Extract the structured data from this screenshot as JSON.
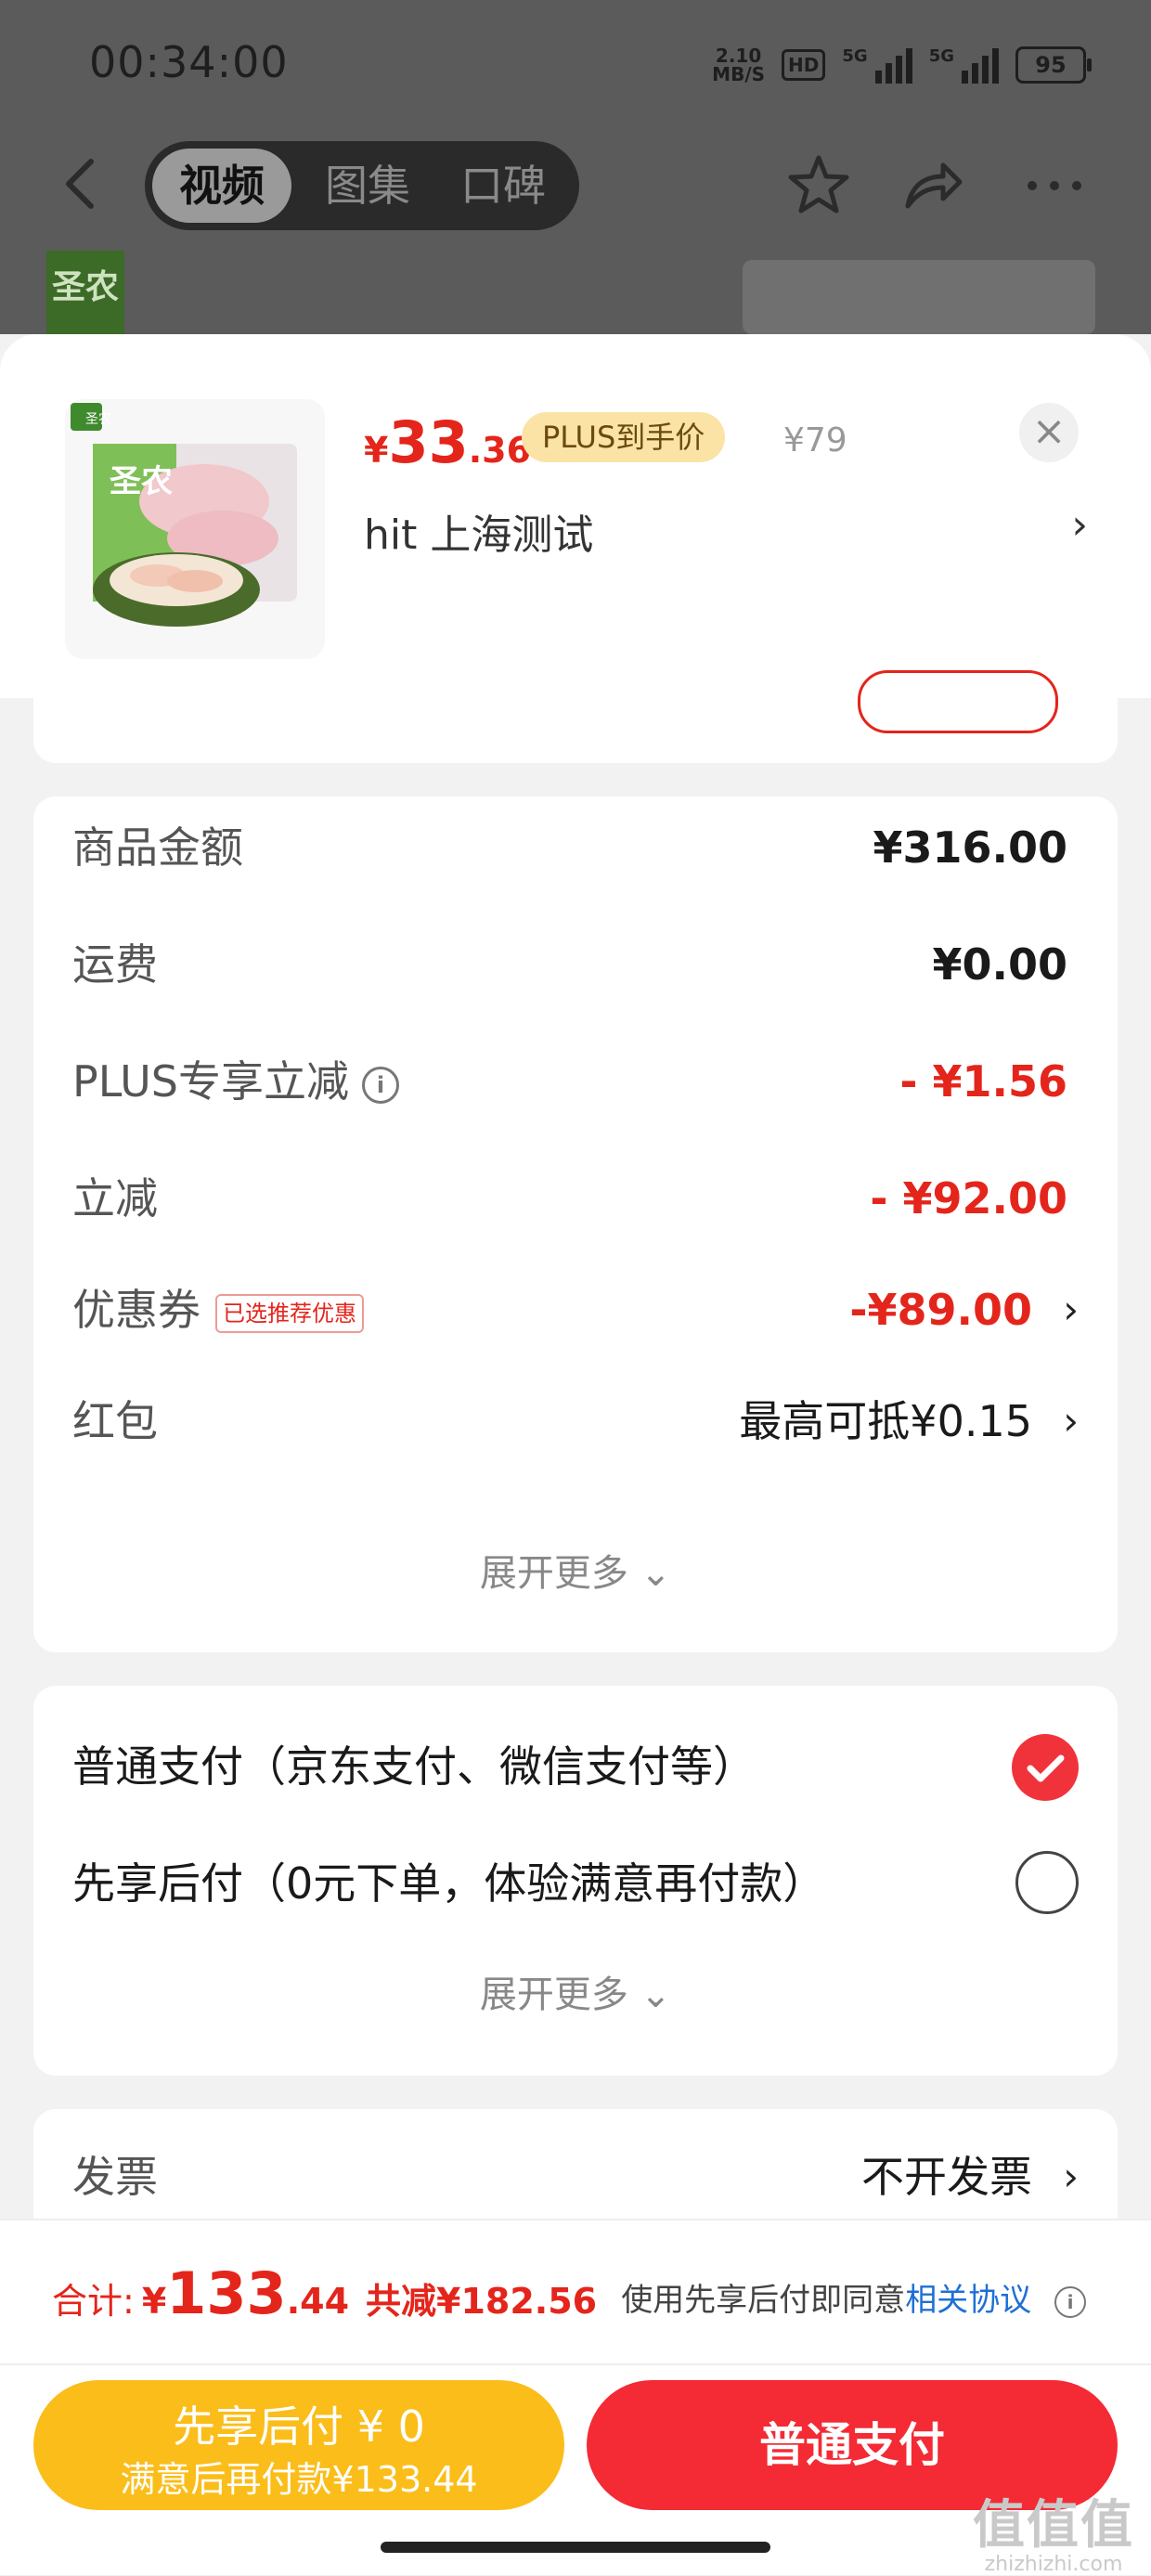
{
  "status_bar": {
    "time": "00:34:00",
    "net_speed_value": "2.10",
    "net_speed_unit": "MB/S",
    "hd": "HD",
    "signal1_label": "5G",
    "signal2_label": "5G",
    "battery": "95"
  },
  "nav": {
    "tabs": [
      {
        "label": "视频",
        "active": true
      },
      {
        "label": "图集",
        "active": false
      },
      {
        "label": "口碑",
        "active": false
      }
    ],
    "bg_logo": "圣农"
  },
  "product": {
    "price_symbol": "¥",
    "price_int": "33",
    "price_dec": ".36",
    "plus_tag": "PLUS到手价",
    "original_price": "¥79",
    "address": "hit  上海测试",
    "brand": "圣农",
    "thumb_badge": "圣农"
  },
  "summary": {
    "rows": [
      {
        "label": "商品金额",
        "value": "¥316.00"
      },
      {
        "label": "运费",
        "value": "¥0.00"
      },
      {
        "label": "PLUS专享立减",
        "value": "- ¥1.56"
      },
      {
        "label": "立减",
        "value": "- ¥92.00"
      },
      {
        "label": "优惠券",
        "tag": "已选推荐优惠",
        "value": "-¥89.00"
      },
      {
        "label": "红包",
        "value": "最高可抵¥0.15"
      }
    ],
    "expand": "展开更多",
    "info_icon": "i"
  },
  "payment": {
    "options": [
      {
        "label": "普通支付（京东支付、微信支付等）",
        "selected": true
      },
      {
        "label": "先享后付（0元下单，体验满意再付款）",
        "selected": false
      }
    ],
    "expand": "展开更多"
  },
  "invoice": {
    "label": "发票",
    "value": "不开发票"
  },
  "bottom": {
    "total_label": "合计:",
    "total_symbol": "¥",
    "total_int": "133",
    "total_dec": ".44",
    "total_saving": "共减¥182.56",
    "agree_text": "使用先享后付即同意",
    "agree_link": "相关协议",
    "btn_later_line1": "先享后付 ¥ 0",
    "btn_later_line2": "满意后再付款¥133.44",
    "btn_pay": "普通支付",
    "watermark_big": "值值值",
    "watermark_small": "zhizhizhi.com"
  },
  "colors": {
    "accent_red": "#e4251b",
    "pay_button": "#f42a34",
    "later_button": "#fbbd1a",
    "plus_tag_bg": "#fbe3a6",
    "link_blue": "#1f6fd6"
  },
  "icons": [
    "back-icon",
    "star-icon",
    "share-icon",
    "more-icon",
    "close-icon",
    "chevron-right-icon",
    "info-icon",
    "check-icon",
    "chevron-down-icon"
  ]
}
